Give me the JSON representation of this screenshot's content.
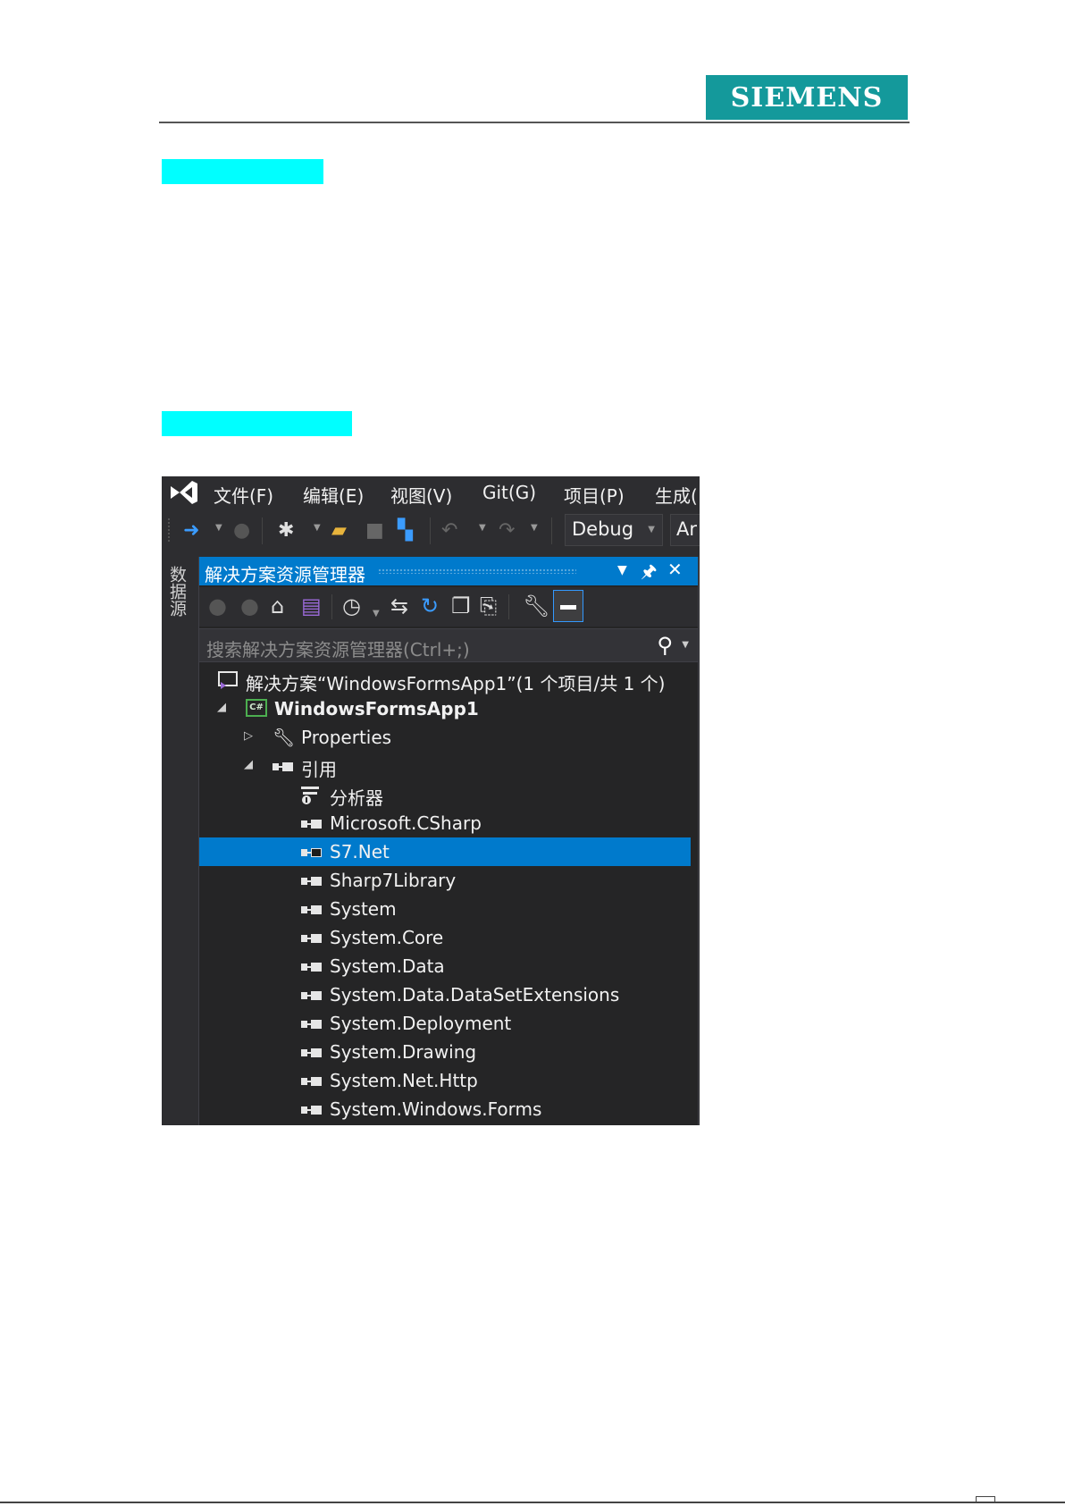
{
  "header": {
    "brand": "SIEMENS"
  },
  "vs": {
    "menu": [
      "文件(F)",
      "编辑(E)",
      "视图(V)",
      "Git(G)",
      "项目(P)",
      "生成("
    ],
    "toolbar": {
      "configuration": "Debug",
      "platform": "Ar"
    },
    "side_tab": "数据源",
    "solution_explorer": {
      "title": "解决方案资源管理器",
      "search_placeholder": "搜索解决方案资源管理器(Ctrl+;)",
      "tree": [
        {
          "label": "解决方案“WindowsFormsApp1”(1 个项目/共 1 个)",
          "icon": "solution-icon"
        },
        {
          "label": "WindowsFormsApp1",
          "icon": "csharp-project-icon",
          "expanded": true,
          "bold": true
        },
        {
          "label": "Properties",
          "icon": "wrench-icon",
          "expanded": false
        },
        {
          "label": "引用",
          "icon": "reference-icon",
          "expanded": true
        },
        {
          "label": "分析器",
          "icon": "analyzer-icon"
        },
        {
          "label": "Microsoft.CSharp",
          "icon": "reference-icon"
        },
        {
          "label": "S7.Net",
          "icon": "reference-icon",
          "selected": true
        },
        {
          "label": "Sharp7Library",
          "icon": "reference-icon"
        },
        {
          "label": "System",
          "icon": "reference-icon"
        },
        {
          "label": "System.Core",
          "icon": "reference-icon"
        },
        {
          "label": "System.Data",
          "icon": "reference-icon"
        },
        {
          "label": "System.Data.DataSetExtensions",
          "icon": "reference-icon"
        },
        {
          "label": "System.Deployment",
          "icon": "reference-icon"
        },
        {
          "label": "System.Drawing",
          "icon": "reference-icon"
        },
        {
          "label": "System.Net.Http",
          "icon": "reference-icon"
        },
        {
          "label": "System.Windows.Forms",
          "icon": "reference-icon"
        }
      ]
    }
  }
}
